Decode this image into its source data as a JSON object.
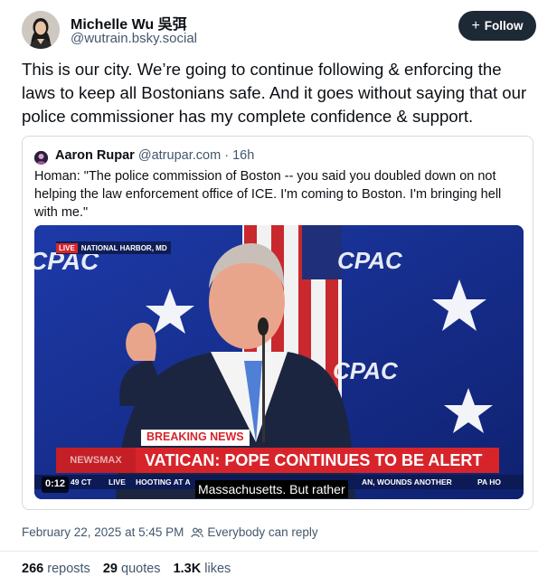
{
  "author": {
    "name": "Michelle Wu 吳弭",
    "handle": "@wutrain.bsky.social"
  },
  "follow_label": "Follow",
  "post_text": "This is our city. We’re going to continue following & enforcing the laws to keep all Bostonians safe. And it goes without saying that our police commissioner has my complete confidence & support.",
  "quote": {
    "name": "Aaron Rupar",
    "handle": "@atrupar.com",
    "separator": "·",
    "age": "16h",
    "text": "Homan: \"The police commission of Boston -- you said you doubled down on not helping the law enforcement office of ICE. I'm coming to Boston. I'm bringing hell with me.\"",
    "video": {
      "live_badge": "LIVE",
      "location": "NATIONAL HARBOR, MD",
      "backdrop_logo": "CPAC",
      "breaking_label": "BREAKING NEWS",
      "headline": "VATICAN: POPE CONTINUES TO BE ALERT",
      "network": "NEWSMAX",
      "ticker_time": "49 CT",
      "ticker_live": "LIVE",
      "ticker_text": "HOOTING AT A",
      "ticker_text_right": "AN, WOUNDS ANOTHER",
      "ticker_edge": "PA HO",
      "timestamp": "0:12",
      "caption": "Massachusetts. But rather"
    }
  },
  "meta": {
    "datetime": "February 22, 2025 at 5:45 PM",
    "reply_setting": "Everybody can reply"
  },
  "stats": {
    "reposts_count": "266",
    "reposts_label": "reposts",
    "quotes_count": "29",
    "quotes_label": "quotes",
    "likes_count": "1.3K",
    "likes_label": "likes"
  },
  "colors": {
    "follow_bg": "#1e2936",
    "secondary_text": "#42576c",
    "border": "#d4dbe2",
    "stage_blue": "#142a8c",
    "breaking_red": "#d7242b"
  }
}
